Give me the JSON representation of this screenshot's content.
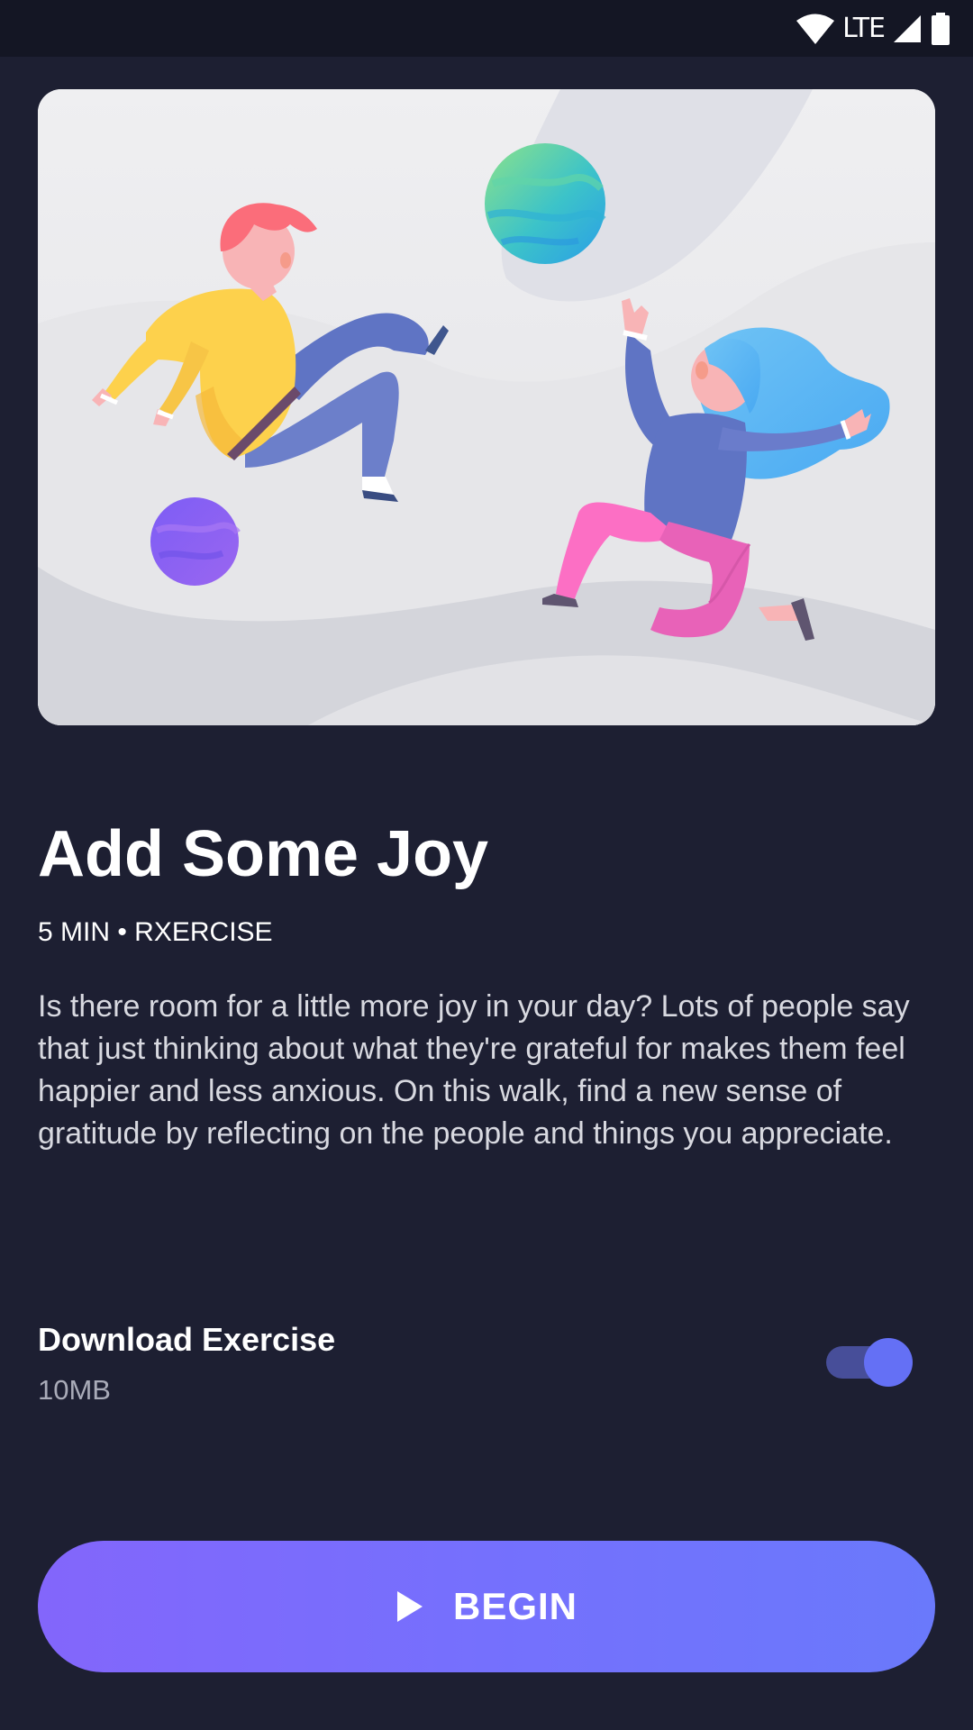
{
  "status_bar": {
    "network_label": "LTE",
    "icons": [
      "wifi-icon",
      "cell-signal-icon",
      "battery-icon"
    ]
  },
  "hero": {
    "illustration": "two-people-floating-with-planets"
  },
  "exercise": {
    "title": "Add Some Joy",
    "meta": "5 MIN • RXERCISE",
    "description": "Is there room for a little more joy in your day? Lots of people say that just thinking about what they're grateful for makes them feel happier and less anxious. On this walk, find a new sense of gratitude by reflecting on the people and things you appreciate."
  },
  "download": {
    "label": "Download Exercise",
    "size": "10MB",
    "enabled": true
  },
  "begin_button": {
    "label": "BEGIN",
    "icon": "play-icon"
  },
  "colors": {
    "background": "#1d1f32",
    "status_bar": "#141624",
    "accent": "#6470f5",
    "button_gradient_start": "#8366fb",
    "button_gradient_end": "#6a79fb"
  }
}
